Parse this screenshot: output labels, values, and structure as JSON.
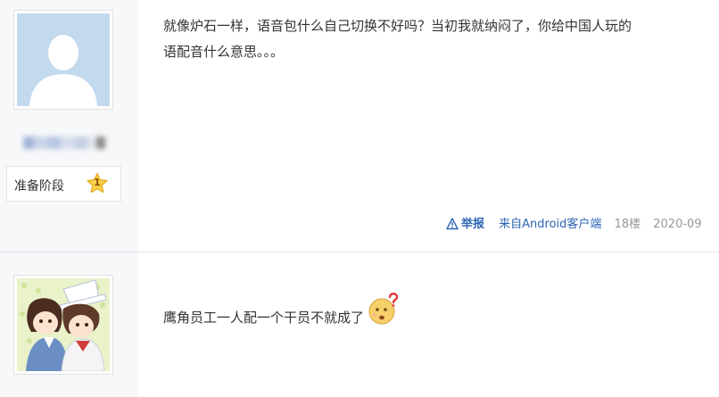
{
  "posts": [
    {
      "level_name": "准备阶段",
      "level_num": "1",
      "content_lines": [
        "就像炉石一样，语音包什么自己切换不好吗？当初我就纳闷了，你给中国人玩的",
        "语配音什么意思。。。"
      ],
      "report": "举报",
      "source": "来自Android客户端",
      "floor": "18楼",
      "date": "2020-09"
    },
    {
      "content": "鹰角员工一人配一个干员不就成了",
      "emoji": "confused-face-emoji"
    }
  ],
  "colors": {
    "link": "#2d64b3",
    "muted": "#999999",
    "sidebar": "#f7f8fa",
    "avatar_default": "#c3d9ee"
  }
}
